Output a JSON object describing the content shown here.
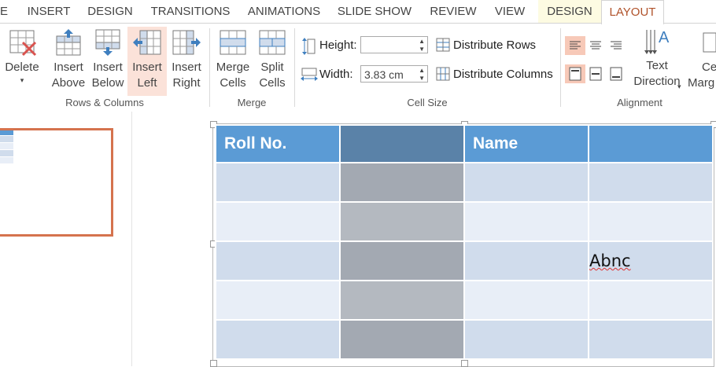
{
  "tabs": [
    {
      "label": "E",
      "active": false
    },
    {
      "label": "INSERT",
      "active": false
    },
    {
      "label": "DESIGN",
      "active": false
    },
    {
      "label": "TRANSITIONS",
      "active": false
    },
    {
      "label": "ANIMATIONS",
      "active": false
    },
    {
      "label": "SLIDE SHOW",
      "active": false
    },
    {
      "label": "REVIEW",
      "active": false
    },
    {
      "label": "VIEW",
      "active": false
    },
    {
      "label": "DESIGN",
      "active": false,
      "contextual": true
    },
    {
      "label": "LAYOUT",
      "active": true,
      "contextual": true
    }
  ],
  "ribbon": {
    "rows_columns": {
      "delete_label": "Delete",
      "insert_above_l1": "Insert",
      "insert_above_l2": "Above",
      "insert_below_l1": "Insert",
      "insert_below_l2": "Below",
      "insert_left_l1": "Insert",
      "insert_left_l2": "Left",
      "insert_right_l1": "Insert",
      "insert_right_l2": "Right",
      "group_label": "Rows & Columns"
    },
    "merge": {
      "merge_l1": "Merge",
      "merge_l2": "Cells",
      "split_l1": "Split",
      "split_l2": "Cells",
      "group_label": "Merge"
    },
    "cell_size": {
      "height_label": "Height:",
      "height_value": "",
      "width_label": "Width:",
      "width_value": "3.83 cm",
      "distribute_rows": "Distribute Rows",
      "distribute_columns": "Distribute Columns",
      "group_label": "Cell Size"
    },
    "alignment": {
      "text_direction_l1": "Text",
      "text_direction_l2": "Direction",
      "cell_margins_l1": "Ce",
      "cell_margins_l2": "Marg",
      "group_label": "Alignment"
    }
  },
  "table": {
    "headers": [
      "Roll No.",
      "",
      "Name",
      ""
    ],
    "cell_text": "Abnc"
  },
  "colors": {
    "accent": "#b0522a",
    "header_blue": "#5b9bd5",
    "selection": "#fbe2d9"
  }
}
